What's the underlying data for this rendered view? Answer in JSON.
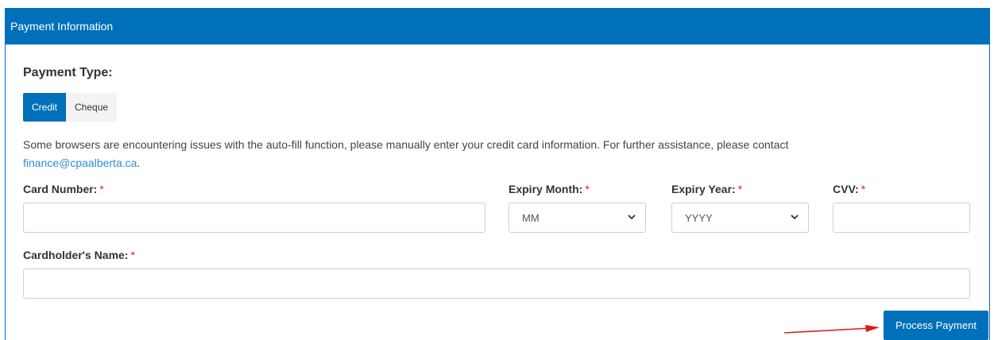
{
  "panel": {
    "title": "Payment Information"
  },
  "payment_type": {
    "title": "Payment Type:",
    "tabs": [
      {
        "label": "Credit",
        "active": true
      },
      {
        "label": "Cheque",
        "active": false
      }
    ]
  },
  "notice": {
    "text": "Some browsers are encountering issues with the auto-fill function, please manually enter your credit card information. For further assistance, please contact",
    "email": "finance@cpaalberta.ca",
    "period": "."
  },
  "fields": {
    "card_number": {
      "label": "Card Number:",
      "required_mark": "*",
      "value": ""
    },
    "expiry_month": {
      "label": "Expiry Month:",
      "required_mark": "*",
      "selected": "MM"
    },
    "expiry_year": {
      "label": "Expiry Year:",
      "required_mark": "*",
      "selected": "YYYY"
    },
    "cvv": {
      "label": "CVV:",
      "required_mark": "*",
      "value": ""
    },
    "cardholder_name": {
      "label": "Cardholder's Name:",
      "required_mark": "*",
      "value": ""
    }
  },
  "actions": {
    "process_payment": "Process Payment"
  },
  "colors": {
    "primary": "#0070ba",
    "required": "#e0201b",
    "link": "#2a8fd6",
    "annotation_arrow": "#d9201a"
  }
}
